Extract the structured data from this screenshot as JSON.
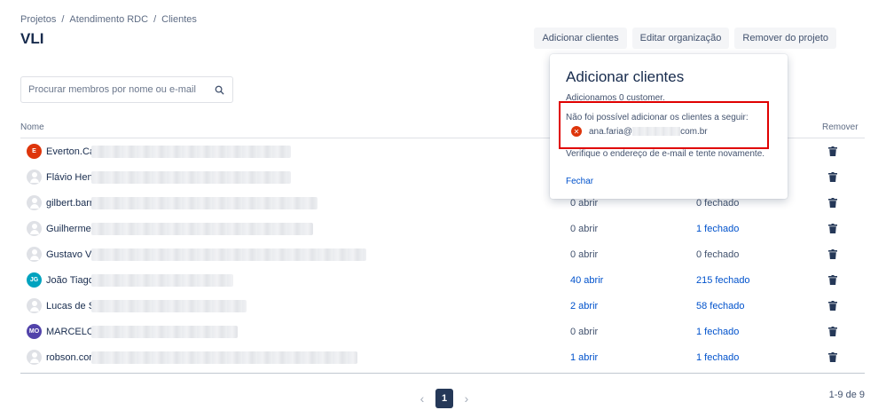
{
  "breadcrumb": [
    "Projetos",
    "/",
    "Atendimento RDC",
    "/",
    "Clientes"
  ],
  "page_title": "VLI",
  "actions": {
    "add_customers": "Adicionar clientes",
    "edit_org": "Editar organização",
    "remove_project": "Remover do projeto"
  },
  "search": {
    "placeholder": "Procurar membros por nome ou e-mail",
    "value": ""
  },
  "columns": {
    "name": "Nome",
    "remove": "Remover"
  },
  "rows": [
    {
      "name": "Everton.Ca",
      "avatar_text": "E",
      "avatar_color": "#de350b",
      "open": "",
      "closed": "",
      "open_link": false,
      "closed_link": false
    },
    {
      "name": "Flávio Henr",
      "avatar_text": "",
      "avatar_color": "",
      "open": "",
      "closed": "",
      "open_link": false,
      "closed_link": false
    },
    {
      "name": "gilbert.barr",
      "avatar_text": "",
      "avatar_color": "",
      "open": "0 abrir",
      "closed": "0 fechado",
      "open_link": false,
      "closed_link": false
    },
    {
      "name": "Guilherme",
      "avatar_text": "",
      "avatar_color": "",
      "open": "0 abrir",
      "closed": "1 fechado",
      "open_link": false,
      "closed_link": true
    },
    {
      "name": "Gustavo Vi",
      "avatar_text": "",
      "avatar_color": "",
      "open": "0 abrir",
      "closed": "0 fechado",
      "open_link": false,
      "closed_link": false
    },
    {
      "name": "João Tiago",
      "avatar_text": "JG",
      "avatar_color": "#00a3bf",
      "open": "40 abrir",
      "closed": "215 fechado",
      "open_link": true,
      "closed_link": true
    },
    {
      "name": "Lucas de Sc",
      "avatar_text": "",
      "avatar_color": "",
      "open": "2 abrir",
      "closed": "58 fechado",
      "open_link": true,
      "closed_link": true
    },
    {
      "name": "MARCELO",
      "avatar_text": "MO",
      "avatar_color": "#5243aa",
      "open": "0 abrir",
      "closed": "1 fechado",
      "open_link": false,
      "closed_link": true
    },
    {
      "name": "robson.cor",
      "avatar_text": "",
      "avatar_color": "",
      "open": "1 abrir",
      "closed": "1 fechado",
      "open_link": true,
      "closed_link": true
    }
  ],
  "pagination": {
    "current": "1",
    "prev": "‹",
    "next": "›",
    "count": "1-9 de 9"
  },
  "popup": {
    "title": "Adicionar clientes",
    "subtitle": "Adicionamos 0 customer.",
    "error_title": "Não foi possível adicionar os clientes a seguir:",
    "error_email_start": "ana.faria@",
    "error_email_end": "com.br",
    "verify": "Verifique o endereço de e-mail e tente novamente.",
    "close": "Fechar"
  },
  "icons": {
    "search": "search-icon",
    "trash": "trash-icon",
    "error": "error-icon"
  },
  "colors": {
    "link": "#0052cc",
    "error": "#de350b",
    "highlight_box": "#e00000",
    "page_active": "#253858"
  }
}
